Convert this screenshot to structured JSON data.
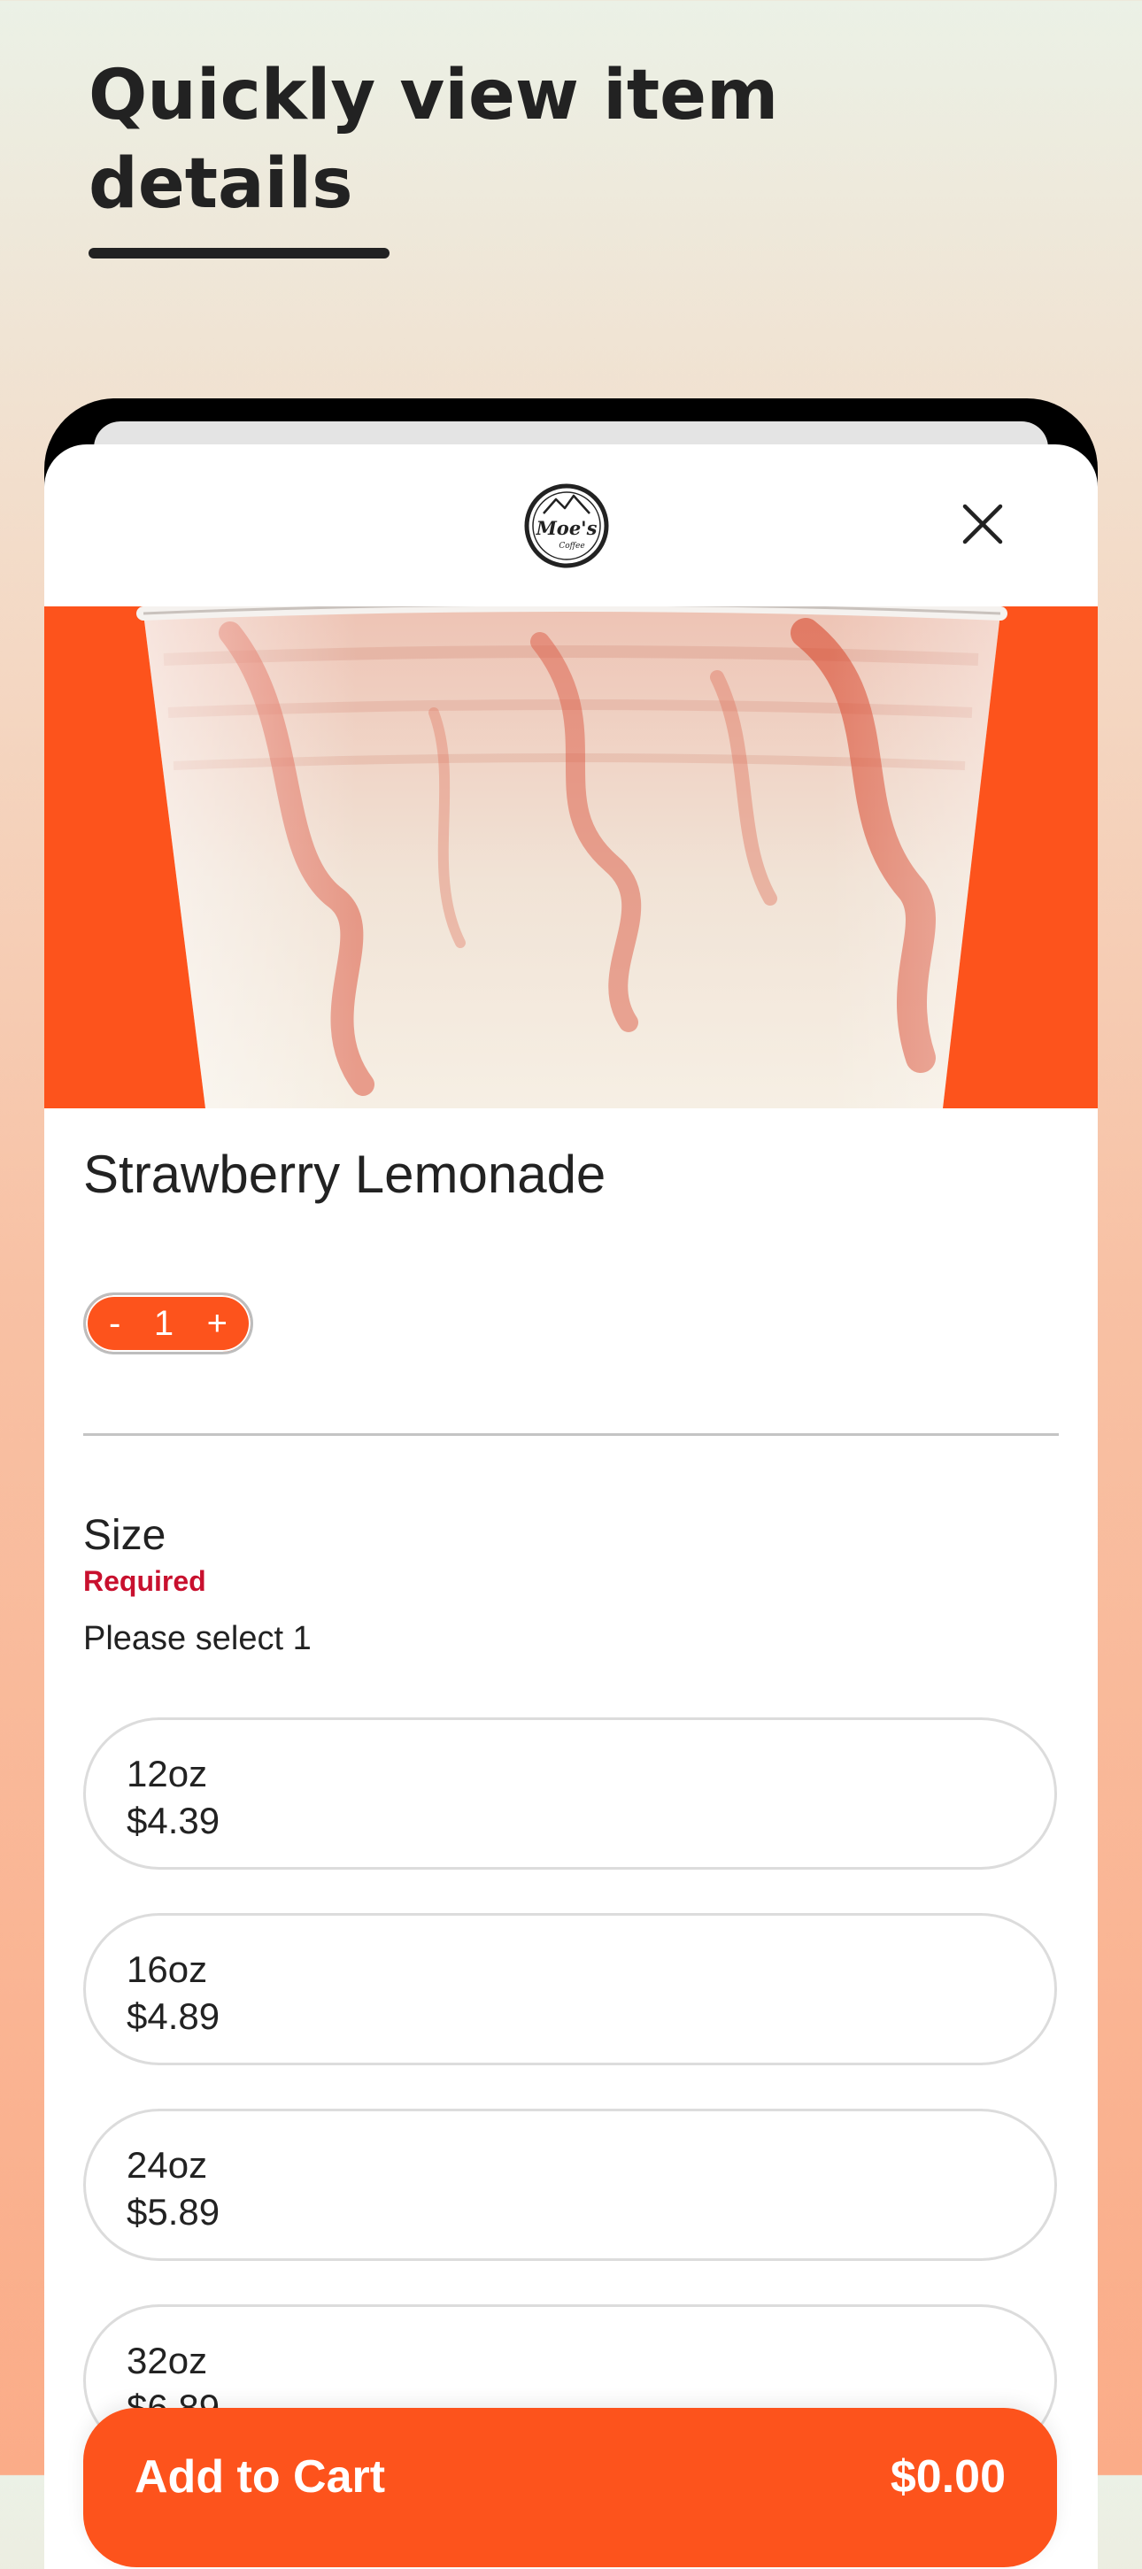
{
  "headline": "Quickly view item details",
  "colors": {
    "accent": "#fd531c",
    "required": "#c8102e",
    "text": "#222222"
  },
  "modal": {
    "brand_logo": "Moe's Coffee",
    "close_icon": "close-icon"
  },
  "item": {
    "name": "Strawberry Lemonade",
    "image": "strawberry-lemonade-cup",
    "quantity": "1",
    "decrement_label": "-",
    "increment_label": "+"
  },
  "size_group": {
    "title": "Size",
    "required_label": "Required",
    "hint": "Please select 1",
    "options": [
      {
        "size": "12oz",
        "price": "$4.39"
      },
      {
        "size": "16oz",
        "price": "$4.89"
      },
      {
        "size": "24oz",
        "price": "$5.89"
      },
      {
        "size": "32oz",
        "price": "$6.89"
      }
    ]
  },
  "cart": {
    "label": "Add to Cart",
    "total": "$0.00"
  }
}
